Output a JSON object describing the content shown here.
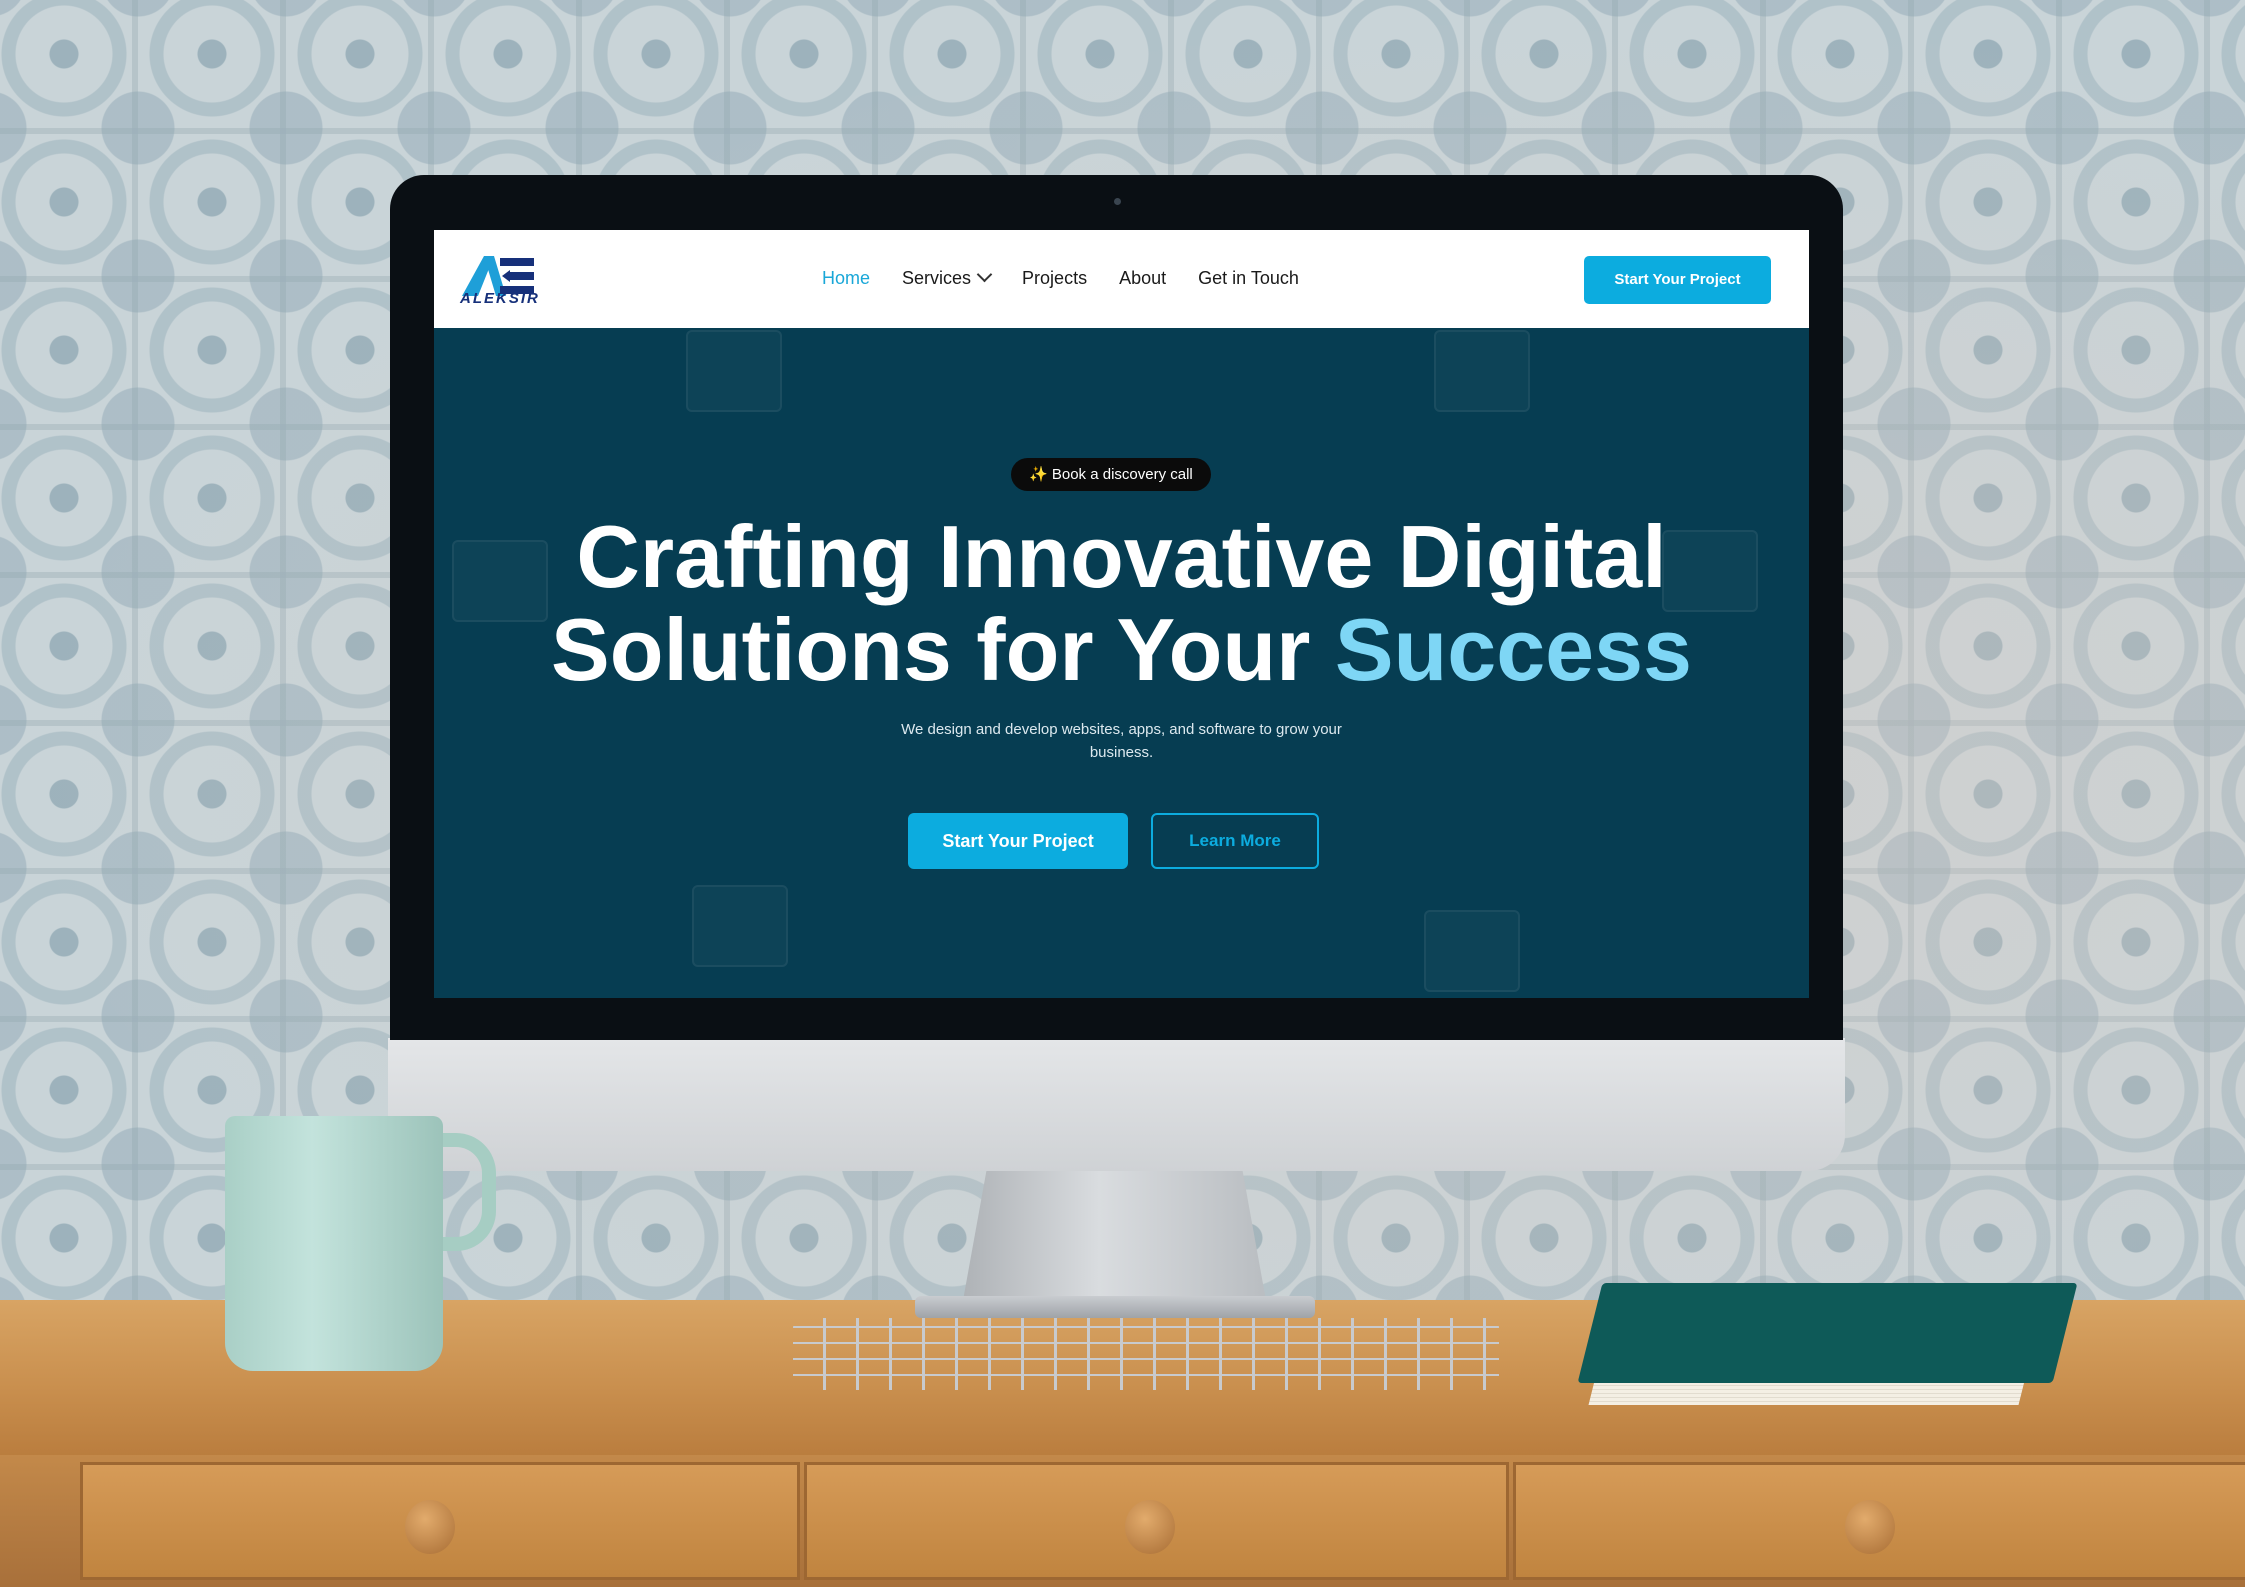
{
  "nav": {
    "logo_text": "ALEKSIR",
    "items": [
      {
        "label": "Home",
        "active": true
      },
      {
        "label": "Services",
        "active": false
      },
      {
        "label": "Projects",
        "active": false
      },
      {
        "label": "About",
        "active": false
      },
      {
        "label": "Get in Touch",
        "active": false
      }
    ],
    "cta_label": "Start Your Project"
  },
  "hero": {
    "pill_icon": "✨",
    "pill_label": "Book a discovery call",
    "headline_line1": "Crafting Innovative Digital",
    "headline_line2_start": "Solutions for Your",
    "headline_accent": "Success",
    "subtitle": "We design and develop websites, apps, and software to grow your business.",
    "primary_button": "Start Your Project",
    "secondary_button": "Learn More"
  },
  "colors": {
    "accent": "#0cacdf",
    "hero_background": "#063d52",
    "accent_text": "#7ed6f5"
  }
}
